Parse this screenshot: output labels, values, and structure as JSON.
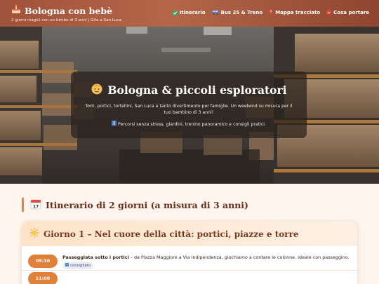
{
  "header": {
    "brand_title": "Bologna con bebè",
    "brand_subtitle": "2 giorni magici con un bimbo di 3 anni | Gita a San Luca",
    "brand_icon": "cake-icon",
    "nav": [
      {
        "label": "Itinerario",
        "icon": "check-box-icon",
        "color": "#3ea86b"
      },
      {
        "label": "Bus 25 & Treno",
        "icon": "bus-icon",
        "color": "#5b79b0"
      },
      {
        "label": "Mappa tracciato",
        "icon": "pin-icon",
        "color": "#e34a4a"
      },
      {
        "label": "Cosa portare",
        "icon": "backpack-icon",
        "color": "#d64a3a"
      }
    ]
  },
  "hero": {
    "title": "Bologna & piccoli esploratori",
    "title_icon": "baby-face-icon",
    "description": "Torri, portici, tortellini, San Luca e tanto divertimento per famiglie. Un weekend su misura per il tuo bambino di 3 anni!",
    "note": "Percorsi senza stress, giardini, trenino panoramico e consigli pratici.",
    "note_icon": "stroller-icon"
  },
  "section": {
    "title": "Itinerario di 2 giorni (a misura di 3 anni)",
    "icon": "calendar-icon"
  },
  "day1": {
    "title": "Giorno 1 – Nel cuore della città: portici, piazze e torre",
    "icon": "sun-icon",
    "rows": [
      {
        "time": "09:30",
        "title": "Passeggiata sotto i portici",
        "text": " – da Piazza Maggiore a Via Indipendenza, giochiamo a contare le colonne. Ideale con passeggino.",
        "badge": "consigliato"
      },
      {
        "time": "11:00",
        "title": "",
        "text": "",
        "badge": ""
      }
    ]
  },
  "colors": {
    "header": "#a0523a",
    "accent": "#e0813a",
    "title": "#6b2e1c",
    "background": "#fdf5ee"
  }
}
